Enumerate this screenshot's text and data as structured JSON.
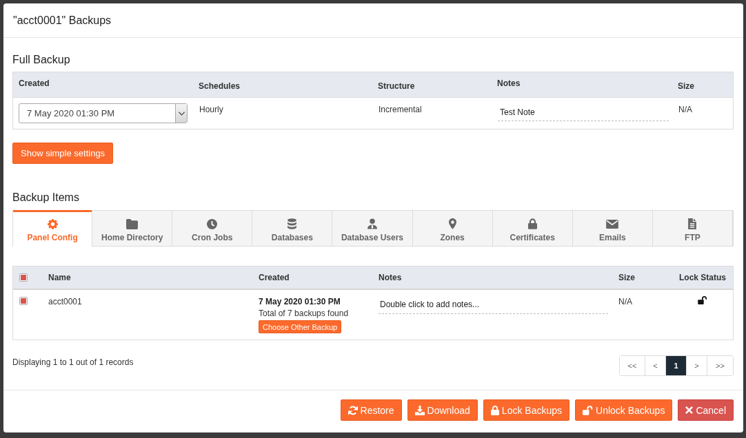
{
  "dialog": {
    "title": "\"acct0001\" Backups"
  },
  "full_backup": {
    "heading": "Full Backup",
    "columns": [
      "Created",
      "Schedules",
      "Structure",
      "Notes",
      "Size"
    ],
    "row": {
      "created": "7 May 2020 01:30 PM",
      "schedules": "Hourly",
      "structure": "Incremental",
      "notes": "Test Note",
      "size": "N/A"
    },
    "toggle_button": "Show simple settings"
  },
  "backup_items": {
    "heading": "Backup Items",
    "tabs": [
      {
        "label": "Panel Config",
        "selected": true
      },
      {
        "label": "Home Directory",
        "selected": false
      },
      {
        "label": "Cron Jobs",
        "selected": false
      },
      {
        "label": "Databases",
        "selected": false
      },
      {
        "label": "Database Users",
        "selected": false
      },
      {
        "label": "Zones",
        "selected": false
      },
      {
        "label": "Certificates",
        "selected": false
      },
      {
        "label": "Emails",
        "selected": false
      },
      {
        "label": "FTP",
        "selected": false
      }
    ],
    "table": {
      "select_all_checked": true,
      "columns": [
        "Name",
        "Created",
        "Notes",
        "Size",
        "Lock Status"
      ],
      "rows": [
        {
          "checked": true,
          "name": "acct0001",
          "created": "7 May 2020 01:30 PM",
          "backups_found": "Total of 7 backups found",
          "choose_button": "Choose Other Backup",
          "notes": "Double click to add notes...",
          "size": "N/A",
          "locked": false
        }
      ]
    },
    "summary": "Displaying 1 to 1 out of 1 records",
    "pagination": [
      {
        "label": "<<",
        "selected": false
      },
      {
        "label": "<",
        "selected": false
      },
      {
        "label": "1",
        "selected": true
      },
      {
        "label": ">",
        "selected": false
      },
      {
        "label": ">>",
        "selected": false
      }
    ]
  },
  "footer_buttons": [
    {
      "label": "Restore",
      "kind": "primary"
    },
    {
      "label": "Download",
      "kind": "primary"
    },
    {
      "label": "Lock Backups",
      "kind": "primary"
    },
    {
      "label": "Unlock Backups",
      "kind": "primary"
    },
    {
      "label": "Cancel",
      "kind": "danger"
    }
  ]
}
